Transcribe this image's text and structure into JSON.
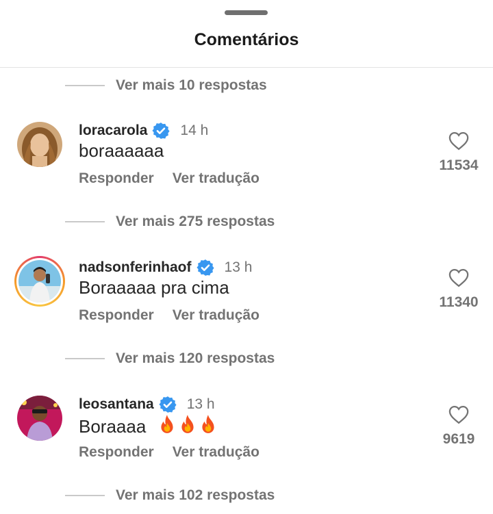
{
  "header": {
    "title": "Comentários"
  },
  "more_replies": [
    {
      "label": "Ver mais 10 respostas"
    },
    {
      "label": "Ver mais 275 respostas"
    },
    {
      "label": "Ver mais 120 respostas"
    },
    {
      "label": "Ver mais 102 respostas"
    }
  ],
  "comments": [
    {
      "username": "loracarola",
      "verified": true,
      "time": "14 h",
      "text": "boraaaaaa",
      "reply_label": "Responder",
      "translate_label": "Ver tradução",
      "likes": "11534"
    },
    {
      "username": "nadsonferinhaof",
      "verified": true,
      "time": "13 h",
      "text": "Boraaaaa pra cima",
      "reply_label": "Responder",
      "translate_label": "Ver tradução",
      "likes": "11340"
    },
    {
      "username": "leosantana",
      "verified": true,
      "time": "13 h",
      "text": "Boraaaa",
      "emoji": "fire-icon x3",
      "reply_label": "Responder",
      "translate_label": "Ver tradução",
      "likes": "9619"
    }
  ],
  "colors": {
    "verified_blue": "#3897f0",
    "secondary_text": "#737373",
    "primary_text": "#262626",
    "story_ring": "#f59a2a"
  }
}
